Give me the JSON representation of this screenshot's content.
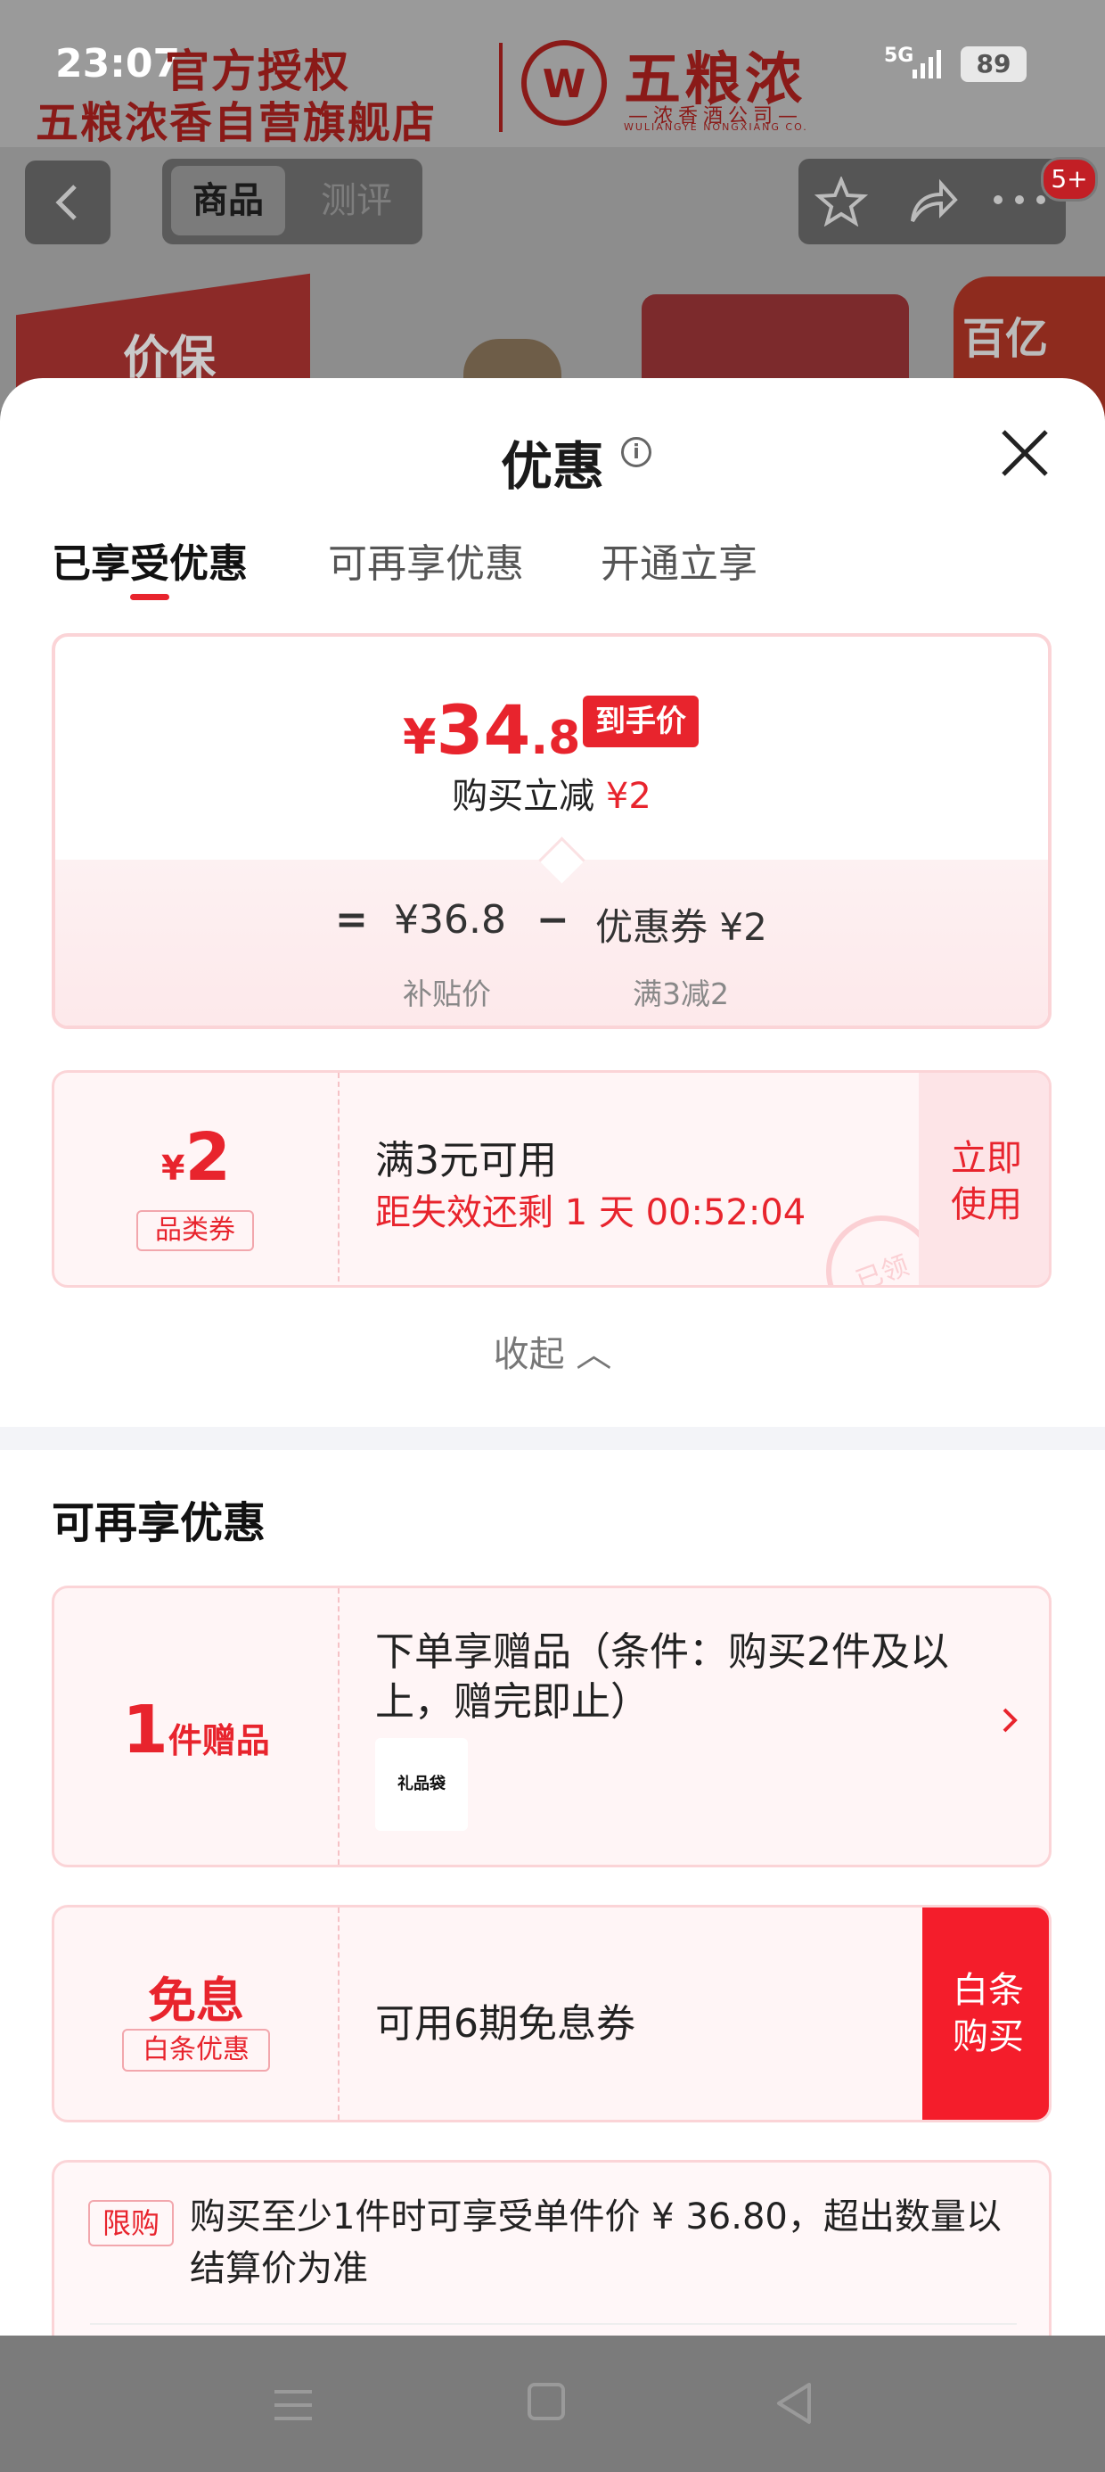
{
  "status_bar": {
    "time": "23:07",
    "network": "5G",
    "battery": "89"
  },
  "banner": {
    "line1": "官方授权",
    "line2": "五粮浓香自营旗舰店",
    "logo_mark": "W",
    "brand_name": "五粮浓",
    "brand_sub": "—浓香酒公司—",
    "brand_en": "WULIANGYE NONGXIANG CO."
  },
  "topbar": {
    "tab_goods": "商品",
    "tab_review": "测评",
    "badge": "5+"
  },
  "promos": {
    "left": "价保",
    "right": "百亿"
  },
  "sheet": {
    "title": "优惠",
    "info_icon": "i",
    "tabs": [
      "已享受优惠",
      "可再享优惠",
      "开通立享"
    ],
    "price_card": {
      "yen": "¥",
      "price_int": "34",
      "price_dec": ".8",
      "price_tag": "到手价",
      "save_text": "购买立减",
      "save_amount": "¥2",
      "eq": "=",
      "base_price": "¥36.8",
      "minus": "−",
      "coupon_label": "优惠券 ¥2",
      "base_price_label": "补贴价",
      "coupon_rule": "满3减2"
    },
    "coupon": {
      "yen": "¥",
      "amount": "2",
      "type": "品类券",
      "condition": "满3元可用",
      "countdown": "距失效还剩 1 天 00:52:04",
      "stamp": "已领",
      "use_line1": "立即",
      "use_line2": "使用"
    },
    "collapse_label": "收起 ︿",
    "section_title": "可再享优惠",
    "gift": {
      "count": "1",
      "unit": "件赠品",
      "desc": "下单享赠品（条件：购买2件及以上，赠完即止）",
      "thumb_label": "礼品袋"
    },
    "interest_free": {
      "main": "免息",
      "tag": "白条优惠",
      "desc": "可用6期免息券",
      "btn_line1": "白条",
      "btn_line2": "购买"
    },
    "limit": {
      "tag": "限购",
      "text": "购买至少1件时可享受单件价 ¥ 36.80，超出数量以结算价为准"
    }
  },
  "colors": {
    "accent": "#e8242d",
    "card_border": "#fbd4d7",
    "card_bg": "#fff5f6"
  },
  "icons": [
    "back-icon",
    "star-icon",
    "share-icon",
    "more-icon",
    "close-icon",
    "info-icon",
    "chevron-up-icon",
    "chevron-right-icon",
    "menu-icon",
    "home-icon",
    "nav-back-icon"
  ]
}
